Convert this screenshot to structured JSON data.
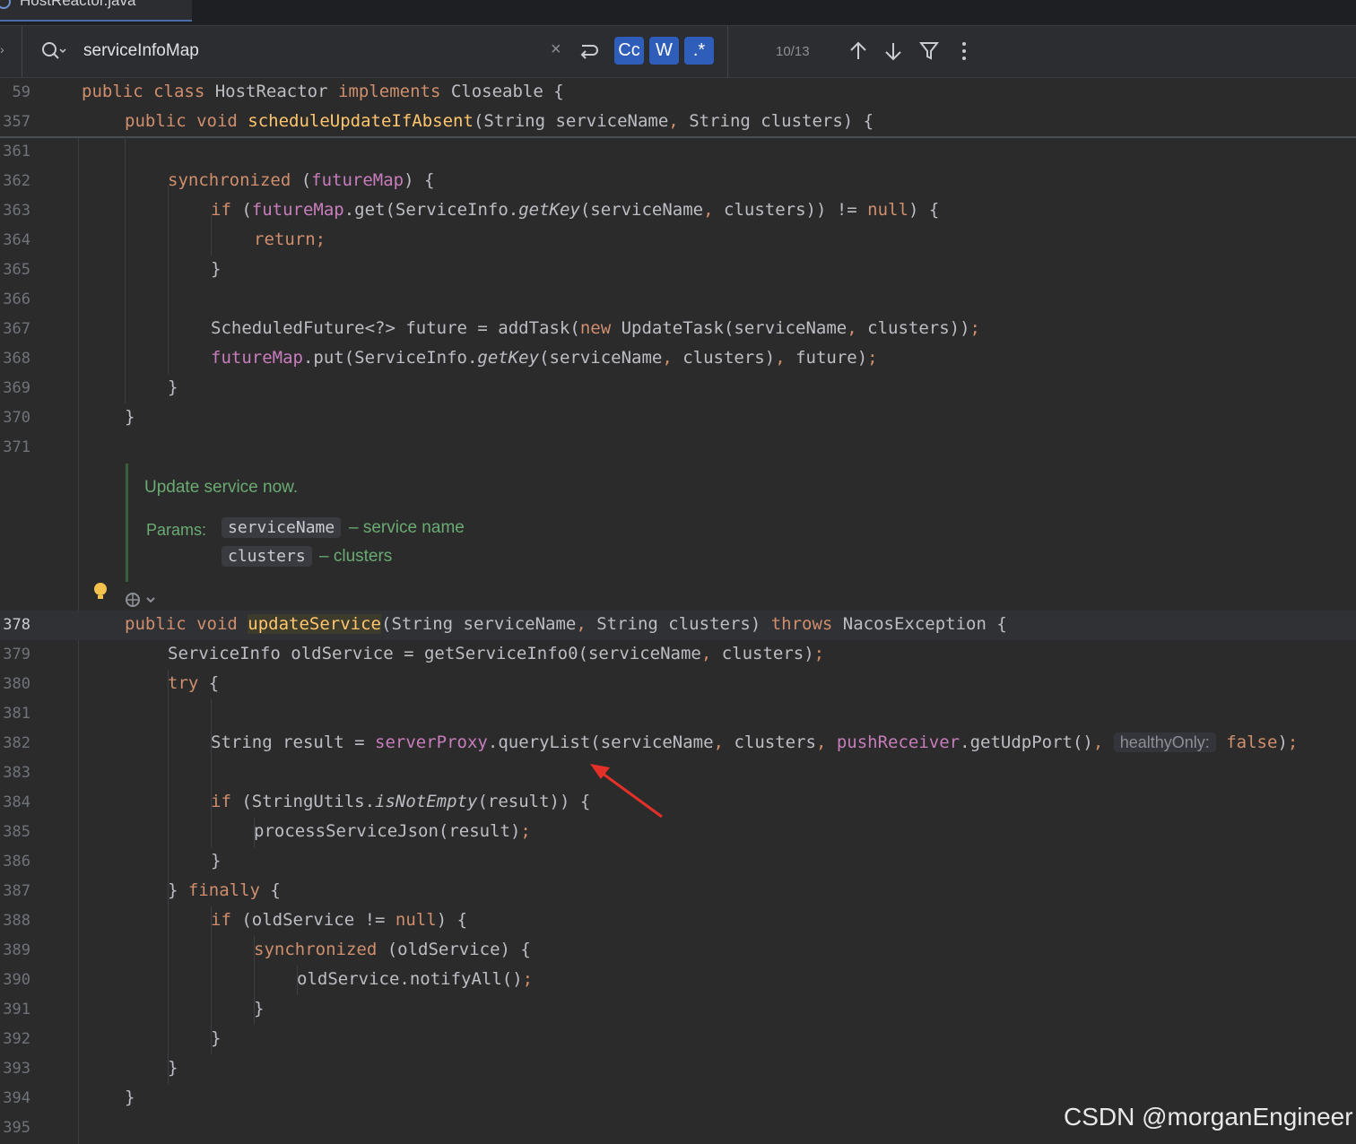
{
  "tab": {
    "file_name": "HostReactor.java"
  },
  "search": {
    "query": "serviceInfoMap",
    "opt_case": "Cc",
    "opt_words": "W",
    "opt_regex": ".*",
    "match_count": "10/13"
  },
  "sticky": [
    {
      "num": "59",
      "parts": [
        [
          "kw",
          "public class "
        ],
        [
          "",
          "HostReactor "
        ],
        [
          "kw",
          "implements "
        ],
        [
          "",
          "Closeable {"
        ]
      ]
    },
    {
      "num": "357",
      "parts": [
        [
          "kw",
          "public void "
        ],
        [
          "fn",
          "scheduleUpdateIfAbsent"
        ],
        [
          "",
          "(String serviceName"
        ],
        [
          "kw",
          ", "
        ],
        [
          "",
          "String clusters) {"
        ]
      ]
    }
  ],
  "lines_top": [
    {
      "num": "361",
      "indent": 0,
      "parts": []
    },
    {
      "num": "362",
      "indent": 2,
      "parts": [
        [
          "kw",
          "synchronized "
        ],
        [
          "",
          "("
        ],
        [
          "fld",
          "futureMap"
        ],
        [
          "",
          ") {"
        ]
      ]
    },
    {
      "num": "363",
      "indent": 3,
      "parts": [
        [
          "kw",
          "if "
        ],
        [
          "",
          "("
        ],
        [
          "fld",
          "futureMap"
        ],
        [
          "",
          ".get(ServiceInfo."
        ],
        [
          "it",
          "getKey"
        ],
        [
          "",
          "(serviceName"
        ],
        [
          "kw",
          ", "
        ],
        [
          "",
          "clusters)) != "
        ],
        [
          "kw",
          "null"
        ],
        [
          "",
          ") {"
        ]
      ]
    },
    {
      "num": "364",
      "indent": 4,
      "parts": [
        [
          "kw",
          "return;"
        ]
      ]
    },
    {
      "num": "365",
      "indent": 3,
      "parts": [
        [
          "",
          "}"
        ]
      ]
    },
    {
      "num": "366",
      "indent": 0,
      "parts": []
    },
    {
      "num": "367",
      "indent": 3,
      "parts": [
        [
          "",
          "ScheduledFuture<?> future = addTask("
        ],
        [
          "kw",
          "new "
        ],
        [
          "",
          "UpdateTask(serviceName"
        ],
        [
          "kw",
          ", "
        ],
        [
          "",
          "clusters))"
        ],
        [
          "kw",
          ";"
        ]
      ]
    },
    {
      "num": "368",
      "indent": 3,
      "parts": [
        [
          "fld",
          "futureMap"
        ],
        [
          "",
          ".put(ServiceInfo."
        ],
        [
          "it",
          "getKey"
        ],
        [
          "",
          "(serviceName"
        ],
        [
          "kw",
          ", "
        ],
        [
          "",
          "clusters)"
        ],
        [
          "kw",
          ", "
        ],
        [
          "",
          "future)"
        ],
        [
          "kw",
          ";"
        ]
      ]
    },
    {
      "num": "369",
      "indent": 2,
      "parts": [
        [
          "",
          "}"
        ]
      ]
    },
    {
      "num": "370",
      "indent": 1,
      "parts": [
        [
          "",
          "}"
        ]
      ]
    },
    {
      "num": "371",
      "indent": 0,
      "parts": []
    }
  ],
  "javadoc": {
    "description": "Update service now.",
    "params_label": "Params:",
    "params": [
      {
        "name": "serviceName",
        "desc": "– service name"
      },
      {
        "name": "clusters",
        "desc": "– clusters"
      }
    ]
  },
  "lines_bottom": [
    {
      "num": "378",
      "indent": 1,
      "current": true,
      "parts": [
        [
          "kw",
          "public void "
        ],
        [
          "fnhl",
          "updateService"
        ],
        [
          "",
          "(String serviceName"
        ],
        [
          "kw",
          ", "
        ],
        [
          "",
          "String clusters) "
        ],
        [
          "kw",
          "throws "
        ],
        [
          "",
          "NacosException {"
        ]
      ]
    },
    {
      "num": "379",
      "indent": 2,
      "parts": [
        [
          "",
          "ServiceInfo oldService = getServiceInfo0(serviceName"
        ],
        [
          "kw",
          ", "
        ],
        [
          "",
          "clusters)"
        ],
        [
          "kw",
          ";"
        ]
      ]
    },
    {
      "num": "380",
      "indent": 2,
      "parts": [
        [
          "kw",
          "try "
        ],
        [
          "",
          "{"
        ]
      ]
    },
    {
      "num": "381",
      "indent": 0,
      "parts": []
    },
    {
      "num": "382",
      "indent": 3,
      "parts": [
        [
          "",
          "String result = "
        ],
        [
          "fld",
          "serverProxy"
        ],
        [
          "",
          ".queryList(serviceName"
        ],
        [
          "kw",
          ", "
        ],
        [
          "",
          "clusters"
        ],
        [
          "kw",
          ", "
        ],
        [
          "fld",
          "pushReceiver"
        ],
        [
          "",
          ".getUdpPort()"
        ],
        [
          "kw",
          ", "
        ],
        [
          "hint",
          "healthyOnly:"
        ],
        [
          "kw",
          " false"
        ],
        [
          "",
          ")"
        ],
        [
          "kw",
          ";"
        ]
      ]
    },
    {
      "num": "383",
      "indent": 0,
      "parts": []
    },
    {
      "num": "384",
      "indent": 3,
      "parts": [
        [
          "kw",
          "if "
        ],
        [
          "",
          "(StringUtils."
        ],
        [
          "it",
          "isNotEmpty"
        ],
        [
          "",
          "(result)) {"
        ]
      ]
    },
    {
      "num": "385",
      "indent": 4,
      "parts": [
        [
          "",
          "processServiceJson(result)"
        ],
        [
          "kw",
          ";"
        ]
      ]
    },
    {
      "num": "386",
      "indent": 3,
      "parts": [
        [
          "",
          "}"
        ]
      ]
    },
    {
      "num": "387",
      "indent": 2,
      "parts": [
        [
          "",
          "} "
        ],
        [
          "kw",
          "finally "
        ],
        [
          "",
          "{"
        ]
      ]
    },
    {
      "num": "388",
      "indent": 3,
      "parts": [
        [
          "kw",
          "if "
        ],
        [
          "",
          "(oldService != "
        ],
        [
          "kw",
          "null"
        ],
        [
          "",
          ") {"
        ]
      ]
    },
    {
      "num": "389",
      "indent": 4,
      "parts": [
        [
          "kw",
          "synchronized "
        ],
        [
          "",
          "(oldService) {"
        ]
      ]
    },
    {
      "num": "390",
      "indent": 5,
      "parts": [
        [
          "",
          "oldService.notifyAll()"
        ],
        [
          "kw",
          ";"
        ]
      ]
    },
    {
      "num": "391",
      "indent": 4,
      "parts": [
        [
          "",
          "}"
        ]
      ]
    },
    {
      "num": "392",
      "indent": 3,
      "parts": [
        [
          "",
          "}"
        ]
      ]
    },
    {
      "num": "393",
      "indent": 2,
      "parts": [
        [
          "",
          "}"
        ]
      ]
    },
    {
      "num": "394",
      "indent": 1,
      "parts": [
        [
          "",
          "}"
        ]
      ]
    },
    {
      "num": "395",
      "indent": 0,
      "parts": []
    }
  ],
  "icons": [
    "search-icon",
    "clear-icon",
    "wrap-icon",
    "arrow-up-icon",
    "arrow-down-icon",
    "filter-icon",
    "more-icon",
    "lightbulb-icon",
    "ai-assistant-icon"
  ],
  "watermark": "CSDN @morganEngineer",
  "colors": {
    "keyword": "#cf8e6d",
    "function": "#ffc66d",
    "field": "#c77dbb",
    "text": "#bcbec4",
    "doc": "#6aab73",
    "annotation_arrow": "#e5302a"
  }
}
